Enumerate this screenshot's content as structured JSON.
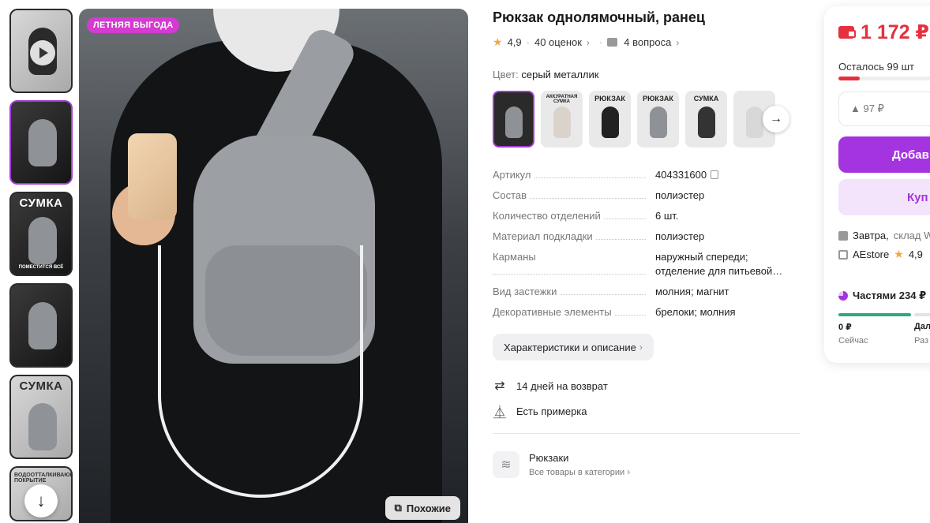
{
  "thumbnails": [
    {
      "kind": "video",
      "title": "",
      "subtitle": ""
    },
    {
      "kind": "photo",
      "title": "",
      "subtitle": ""
    },
    {
      "kind": "promo",
      "title": "СУМКА",
      "subtitle": "ПОМЕСТИТСЯ ВСЁ"
    },
    {
      "kind": "photo",
      "title": "",
      "subtitle": ""
    },
    {
      "kind": "promo-light",
      "title": "СУМКА",
      "subtitle": ""
    },
    {
      "kind": "promo-light",
      "title": "",
      "subtitle": "ВОДООТТАЛКИВАЮЩЕЕ ПОКРЫТИЕ"
    }
  ],
  "main_image": {
    "badge": "ЛЕТНЯЯ ВЫГОДА",
    "similar_label": "Похожие"
  },
  "product": {
    "title": "Рюкзак однолямочный, ранец",
    "rating": "4,9",
    "reviews": "40 оценок",
    "questions": "4 вопроса",
    "color_label": "Цвет:",
    "color_value": "серый металлик"
  },
  "swatches": [
    {
      "text": ""
    },
    {
      "text": "АККУРАТНАЯ СУМКА"
    },
    {
      "text": "РЮКЗАК"
    },
    {
      "text": "РЮКЗАК"
    },
    {
      "text": "СУМКА"
    },
    {
      "text": ""
    }
  ],
  "specs": [
    {
      "key": "Артикул",
      "value": "404331600"
    },
    {
      "key": "Состав",
      "value": "полиэстер"
    },
    {
      "key": "Количество отделений",
      "value": "6 шт."
    },
    {
      "key": "Материал подкладки",
      "value": "полиэстер"
    },
    {
      "key": "Карманы",
      "value": "наружный спереди; отделение для питьевой…"
    },
    {
      "key": "Вид застежки",
      "value": "молния; магнит"
    },
    {
      "key": "Декоративные элементы",
      "value": "брелоки; молния"
    }
  ],
  "chars_button": "Характеристики и описание",
  "features": {
    "return": "14 дней на возврат",
    "fitting": "Есть примерка"
  },
  "category": {
    "name": "Рюкзаки",
    "link": "Все товары в категории"
  },
  "card": {
    "price": "1 172 ₽",
    "stock": "Осталось 99 шт",
    "stock_fraction": 0.18,
    "bonus": "▲ 97 ₽",
    "add_label": "Добав",
    "buy_label": "Куп",
    "delivery_day": "Завтра,",
    "delivery_place": "склад W",
    "store_name": "AEstore",
    "store_rating": "4,9",
    "installments": "Частями 234 ₽",
    "seg1_label": "0 ₽",
    "seg1_sub": "Сейчас",
    "seg2_label": "Дал",
    "seg2_sub": "Раз"
  },
  "colors": {
    "accent": "#a434e0",
    "price": "#e5303e",
    "badge": "#d43bd0"
  }
}
